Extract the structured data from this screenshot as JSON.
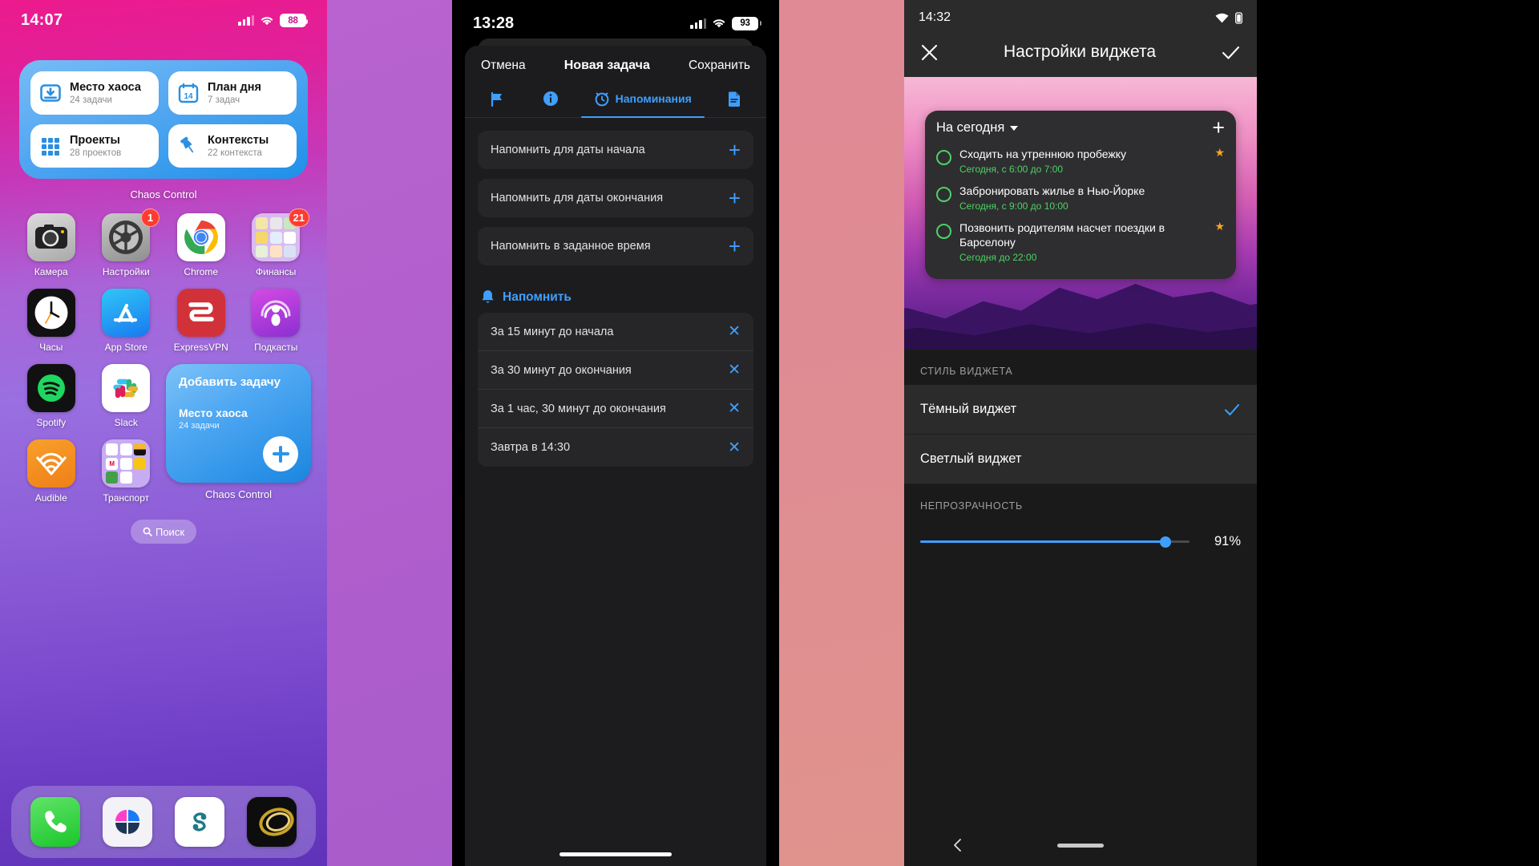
{
  "phone1": {
    "status": {
      "time": "14:07",
      "battery": "88",
      "signal_icon": "cellular-bars-icon",
      "wifi_icon": "wifi-icon",
      "battery_icon": "battery-icon"
    },
    "widget": {
      "label": "Chaos Control",
      "cards": [
        {
          "title": "Место хаоса",
          "sub": "24 задачи",
          "icon": "inbox-icon"
        },
        {
          "title": "План дня",
          "sub": "7 задач",
          "icon": "calendar-icon",
          "day": "14"
        },
        {
          "title": "Проекты",
          "sub": "28 проектов",
          "icon": "grid-icon"
        },
        {
          "title": "Контексты",
          "sub": "22 контекста",
          "icon": "pin-icon"
        }
      ]
    },
    "apps": [
      {
        "label": "Камера",
        "icon": "camera-app-icon"
      },
      {
        "label": "Настройки",
        "icon": "settings-gear-app-icon",
        "badge": "1"
      },
      {
        "label": "Chrome",
        "icon": "chrome-app-icon"
      },
      {
        "label": "Финансы",
        "icon": "finance-folder-icon",
        "badge": "21"
      },
      {
        "label": "Часы",
        "icon": "clock-app-icon"
      },
      {
        "label": "App Store",
        "icon": "app-store-icon"
      },
      {
        "label": "ExpressVPN",
        "icon": "expressvpn-app-icon"
      },
      {
        "label": "Подкасты",
        "icon": "podcasts-app-icon"
      },
      {
        "label": "Spotify",
        "icon": "spotify-app-icon"
      },
      {
        "label": "Slack",
        "icon": "slack-app-icon"
      },
      {
        "label": "Audible",
        "icon": "audible-app-icon"
      },
      {
        "label": "Транспорт",
        "icon": "transport-folder-icon"
      }
    ],
    "add_widget": {
      "title": "Добавить задачу",
      "project": "Место хаоса",
      "sub": "24 задачи",
      "label": "Chaos Control",
      "plus_icon": "plus-icon"
    },
    "search": {
      "label": "Поиск",
      "icon": "search-icon"
    },
    "dock": [
      {
        "label": "Телефон",
        "icon": "phone-app-icon"
      },
      {
        "label": "Fantastical",
        "icon": "pinwheel-app-icon"
      },
      {
        "label": "Scribd",
        "icon": "scribd-app-icon"
      },
      {
        "label": "Chaos",
        "icon": "gold-swirl-app-icon"
      }
    ]
  },
  "phone2": {
    "status": {
      "time": "13:28",
      "battery": "93"
    },
    "header": {
      "cancel": "Отмена",
      "title": "Новая задача",
      "save": "Сохранить"
    },
    "tabs": [
      {
        "label": "",
        "icon": "flag-icon",
        "selected": false
      },
      {
        "label": "",
        "icon": "info-icon",
        "selected": false
      },
      {
        "label": "Напоминания",
        "icon": "alarm-clock-icon",
        "selected": true
      },
      {
        "label": "",
        "icon": "document-icon",
        "selected": false
      }
    ],
    "options": [
      {
        "label": "Напомнить для даты начала",
        "action_icon": "plus-icon"
      },
      {
        "label": "Напомнить для даты окончания",
        "action_icon": "plus-icon"
      },
      {
        "label": "Напомнить в заданное время",
        "action_icon": "plus-icon"
      }
    ],
    "section": {
      "label": "Напомнить",
      "icon": "bell-icon"
    },
    "reminders": [
      {
        "label": "За 15 минут до начала",
        "action_icon": "close-icon"
      },
      {
        "label": "За 30 минут до окончания",
        "action_icon": "close-icon"
      },
      {
        "label": "За 1 час, 30 минут до окончания",
        "action_icon": "close-icon"
      },
      {
        "label": "Завтра в 14:30",
        "action_icon": "close-icon"
      }
    ]
  },
  "phone3": {
    "status": {
      "time": "14:32",
      "wifi_icon": "wifi-icon",
      "battery_icon": "battery-icon"
    },
    "appbar": {
      "title": "Настройки виджета",
      "close_icon": "close-icon",
      "confirm_icon": "check-icon"
    },
    "widget_preview": {
      "list_name": "На сегодня",
      "add_icon": "plus-icon",
      "caret_icon": "chevron-down-icon",
      "tasks": [
        {
          "title": "Сходить на утреннюю пробежку",
          "date": "Сегодня, с 6:00 до 7:00",
          "starred": true
        },
        {
          "title": "Забронировать жилье в Нью-Йорке",
          "date": "Сегодня, с 9:00 до 10:00",
          "starred": false
        },
        {
          "title": "Позвонить родителям насчет поездки в Барселону",
          "date": "Сегодня до 22:00",
          "starred": true
        }
      ]
    },
    "style_section": {
      "caption": "СТИЛЬ ВИДЖЕТА",
      "options": [
        {
          "label": "Тёмный виджет",
          "selected": true,
          "check_icon": "check-icon"
        },
        {
          "label": "Светлый виджет",
          "selected": false
        }
      ]
    },
    "opacity_section": {
      "caption": "НЕПРОЗРАЧНОСТЬ",
      "value": "91%",
      "percent": 91
    },
    "navbar": {
      "back_icon": "back-chevron-icon",
      "home_pill": "home-indicator"
    }
  },
  "colors": {
    "ios_blue": "#3f9fff",
    "widget_blue": "#1f8fe8",
    "green_accent": "#4cd264",
    "star_orange": "#f5a623",
    "badge_red": "#ff3b30"
  }
}
